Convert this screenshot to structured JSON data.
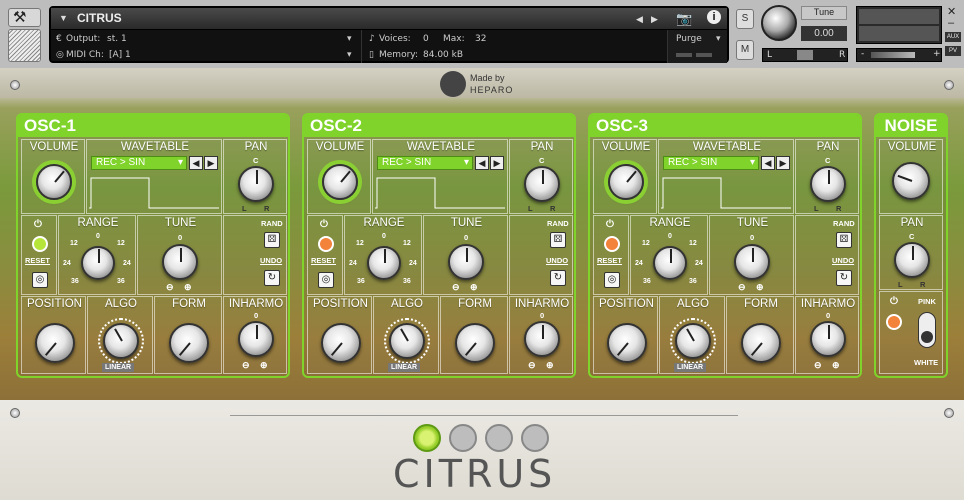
{
  "header": {
    "instrument_title": "CITRUS",
    "output_label": "Output:",
    "output_value": "st. 1",
    "midi_label": "MIDI Ch:",
    "midi_value": "[A] 1",
    "voices_label": "Voices:",
    "voices_value": "0",
    "max_label": "Max:",
    "max_value": "32",
    "memory_label": "Memory:",
    "memory_value": "84.00 kB",
    "purge_label": "Purge",
    "solo_label": "S",
    "mute_label": "M",
    "tune_label": "Tune",
    "tune_value": "0.00",
    "pan_left": "L",
    "pan_right": "R",
    "aux_label": "AUX",
    "pv_label": "PV",
    "vol_minus": "-",
    "vol_plus": "+"
  },
  "branding": {
    "made_by": "Made by",
    "company": "HEPARO",
    "product": "CITRUS"
  },
  "oscillators": [
    {
      "title": "OSC-1",
      "volume": "VOLUME",
      "wavetable": "WAVETABLE",
      "pan": "PAN",
      "wavetable_value": "REC > SIN",
      "range": "RANGE",
      "tune": "TUNE",
      "rand": "RAND",
      "undo": "UNDO",
      "reset": "RESET",
      "position": "POSITION",
      "algo": "ALGO",
      "form": "FORM",
      "inharmo": "INHARMO",
      "algo_value": "LINEAR",
      "active_color": "#b6e63a"
    },
    {
      "title": "OSC-2",
      "volume": "VOLUME",
      "wavetable": "WAVETABLE",
      "pan": "PAN",
      "wavetable_value": "REC > SIN",
      "range": "RANGE",
      "tune": "TUNE",
      "rand": "RAND",
      "undo": "UNDO",
      "reset": "RESET",
      "position": "POSITION",
      "algo": "ALGO",
      "form": "FORM",
      "inharmo": "INHARMO",
      "algo_value": "LINEAR",
      "active_color": "#f3823a"
    },
    {
      "title": "OSC-3",
      "volume": "VOLUME",
      "wavetable": "WAVETABLE",
      "pan": "PAN",
      "wavetable_value": "REC > SIN",
      "range": "RANGE",
      "tune": "TUNE",
      "rand": "RAND",
      "undo": "UNDO",
      "reset": "RESET",
      "position": "POSITION",
      "algo": "ALGO",
      "form": "FORM",
      "inharmo": "INHARMO",
      "algo_value": "LINEAR",
      "active_color": "#f3823a"
    }
  ],
  "noise": {
    "title": "NOISE",
    "volume": "VOLUME",
    "pan": "PAN",
    "pink": "PINK",
    "white": "WHITE"
  },
  "scale": {
    "center": "0",
    "c": "C",
    "l": "L",
    "r": "R",
    "r12": "12",
    "r24": "24",
    "r36": "36"
  },
  "colors": {
    "accent_green": "#7fd32a",
    "lime": "#b6e63a",
    "orange": "#f3823a"
  }
}
